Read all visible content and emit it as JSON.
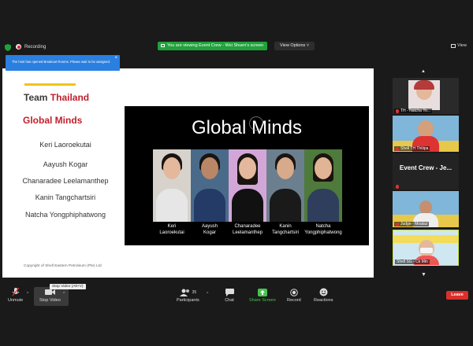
{
  "topbar": {
    "recording_label": "Recording",
    "viewing_banner": "You are viewing Event Crew - Wei Shuen's screen",
    "view_options": "View Options ˅",
    "view_label": "View"
  },
  "notice": {
    "text": "The host has opened Breakout Rooms. Please wait to be assigned.",
    "close": "×"
  },
  "slide": {
    "team_prefix": "Team ",
    "team_country": "Thailand",
    "subtitle": "Global Minds",
    "members": [
      "Keri Laoroekutai",
      "Aayush Kogar",
      "Chanaradee Leelamanthep",
      "Kanin Tangchartsiri",
      "Natcha Yongphiphatwong"
    ],
    "copyright": "Copyright of Shell Eastern Petroleum (Pte) Ltd",
    "panel_title": "Global Minds",
    "photo_names": [
      [
        "Keri",
        "Laoroekutai"
      ],
      [
        "Aayush",
        "Kogar"
      ],
      [
        "Chanaradee",
        "Leelamanthep"
      ],
      [
        "Kanin",
        "Tangchartsiri"
      ],
      [
        "Natcha",
        "Yongphiphatwong"
      ]
    ]
  },
  "participants": [
    {
      "label": "TH - Natcha Yo..."
    },
    {
      "label": "Shell TH Thitipa"
    },
    {
      "label": "Event Crew - Je...",
      "tile_text": "Event Crew - Je..."
    },
    {
      "label": "Judge - Moataz"
    },
    {
      "label": "Shell SG - Ck Min"
    }
  ],
  "toolbar": {
    "unmute": "Unmute",
    "stop_video": "Stop Video",
    "stop_video_tooltip": "Stop Video (Alt+V)",
    "participants": "Participants",
    "participants_count": "35",
    "chat": "Chat",
    "share_screen": "Share Screen",
    "record": "Record",
    "reactions": "Reactions",
    "leave": "Leave"
  },
  "colors": {
    "accent_red": "#c21e2c",
    "accent_yellow": "#f2c319",
    "share_green": "#45c44f",
    "banner_green": "#1fa23a",
    "leave_red": "#d9302c",
    "notice_blue": "#2a7fe0"
  }
}
